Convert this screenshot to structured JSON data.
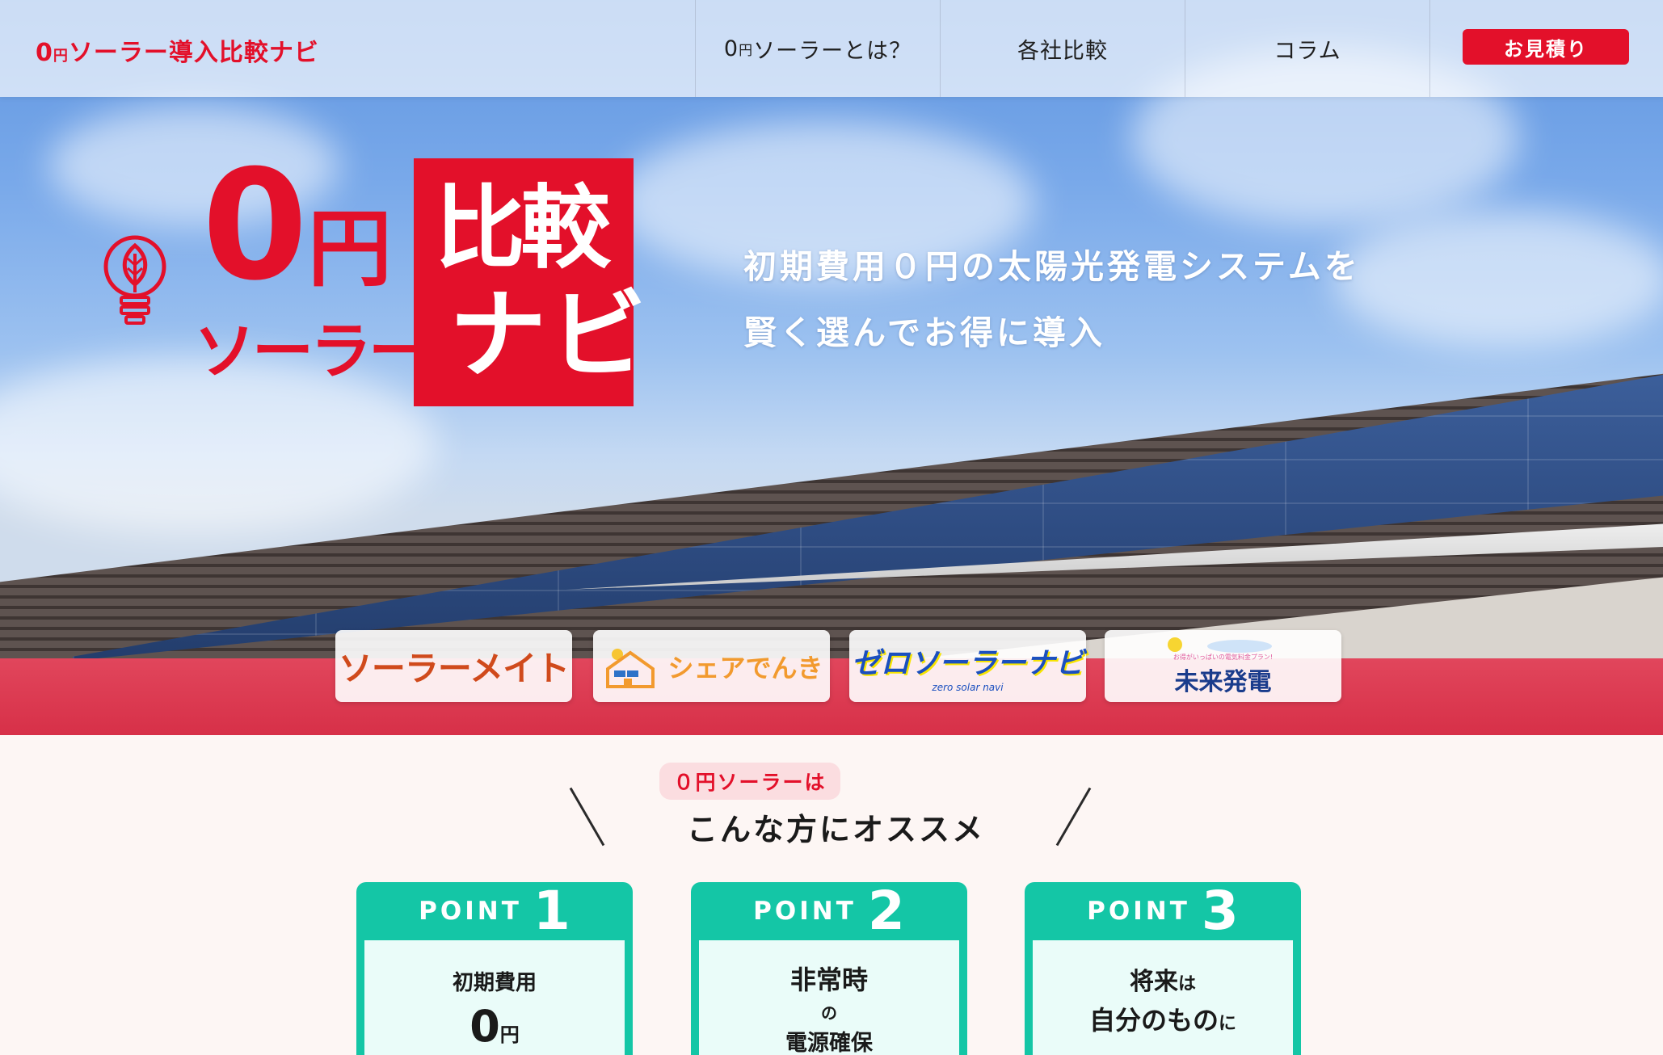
{
  "header": {
    "logo": {
      "zero": "0",
      "yen": "円",
      "rest": "ソーラー導入比較ナビ"
    },
    "nav": [
      {
        "main": "0",
        "small": "円",
        "rest": "ソーラーとは？"
      },
      {
        "label": "各社比較"
      },
      {
        "label": "コラム"
      }
    ],
    "cta": "お見積り"
  },
  "hero": {
    "logo_zero": "0",
    "logo_yen": "円",
    "logo_solar": "ソーラー",
    "logo_box_line1": "比較",
    "logo_box_line2": "ナビ",
    "tagline_1": "初期費用０円の太陽光発電システムを",
    "tagline_2": "賢く選んでお得に導入"
  },
  "brands": [
    {
      "name": "ソーラーメイト",
      "color": "#d04a1c"
    },
    {
      "name": "シェアでんき",
      "color": "#f29a2e"
    },
    {
      "name": "ゼロソーラーナビ",
      "sub": "zero solar navi",
      "color": "#1a4fbf"
    },
    {
      "name": "未来発電",
      "sub": "お得がいっぱいの電気料金プラン!",
      "color": "#1a3c8c"
    }
  ],
  "recommend": {
    "pill": "０円ソーラーは",
    "title": "こんな方にオススメ"
  },
  "points": [
    {
      "label": "POINT",
      "num": "1",
      "line1": "初期費用",
      "big": "0",
      "small": "円"
    },
    {
      "label": "POINT",
      "num": "2",
      "line1": "非常時",
      "mid": "の",
      "line3": "電源確保"
    },
    {
      "label": "POINT",
      "num": "3",
      "line1a": "将来",
      "line1b": "は",
      "line2a": "自分のもの",
      "line2b": "に"
    }
  ],
  "colors": {
    "brand_red": "#e3102a",
    "teal": "#14c6a6",
    "pink_bg": "#fdf6f4"
  }
}
